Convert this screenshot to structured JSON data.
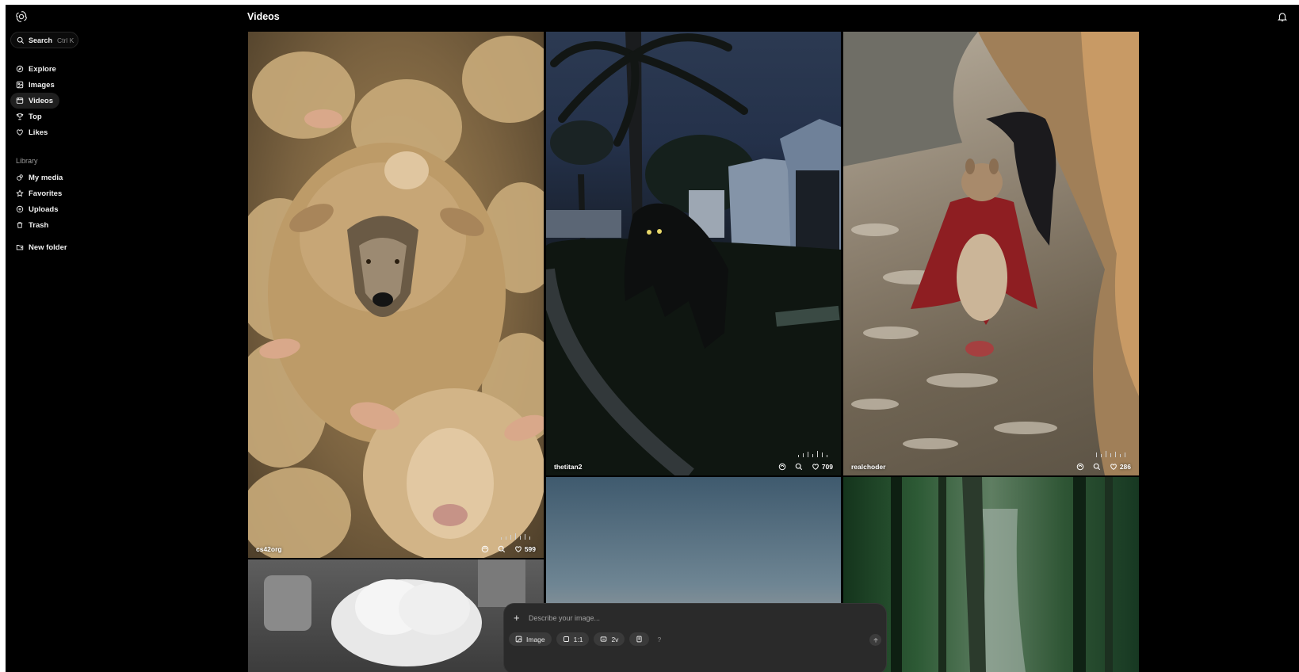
{
  "header": {
    "title": "Videos"
  },
  "sidebar": {
    "search": {
      "label": "Search",
      "shortcut": "Ctrl K"
    },
    "nav": [
      {
        "label": "Explore",
        "icon": "compass-icon"
      },
      {
        "label": "Images",
        "icon": "image-icon"
      },
      {
        "label": "Videos",
        "icon": "video-icon",
        "active": true
      },
      {
        "label": "Top",
        "icon": "trophy-icon"
      },
      {
        "label": "Likes",
        "icon": "heart-icon"
      }
    ],
    "library_label": "Library",
    "library": [
      {
        "label": "My media",
        "icon": "media-icon"
      },
      {
        "label": "Favorites",
        "icon": "star-icon"
      },
      {
        "label": "Uploads",
        "icon": "upload-icon"
      },
      {
        "label": "Trash",
        "icon": "trash-icon"
      }
    ],
    "new_folder": {
      "label": "New folder",
      "icon": "folder-plus-icon"
    }
  },
  "gallery": [
    {
      "user": "cs42org",
      "likes": "599",
      "subject": "wolf among sheep"
    },
    {
      "user": "thetitan2",
      "likes": "709",
      "subject": "creature at night"
    },
    {
      "user": "realchoder",
      "likes": "286",
      "subject": "squirrel in cape"
    },
    {
      "user": "",
      "likes": "",
      "subject": "sky at dusk"
    },
    {
      "user": "",
      "likes": "",
      "subject": "forest waterfall"
    },
    {
      "user": "",
      "likes": "",
      "subject": "chef hat"
    }
  ],
  "composer": {
    "placeholder": "Describe your image...",
    "chips": [
      {
        "label": "Image",
        "icon": "image-icon"
      },
      {
        "label": "1:1",
        "icon": "square-icon"
      },
      {
        "label": "2v",
        "icon": "variations-icon"
      },
      {
        "label": "",
        "icon": "style-icon"
      },
      {
        "label": "?",
        "icon": "help-icon"
      }
    ]
  },
  "colors": {
    "background": "#000000",
    "active_nav": "#1f1f1f",
    "composer": "#2a2a2a"
  }
}
